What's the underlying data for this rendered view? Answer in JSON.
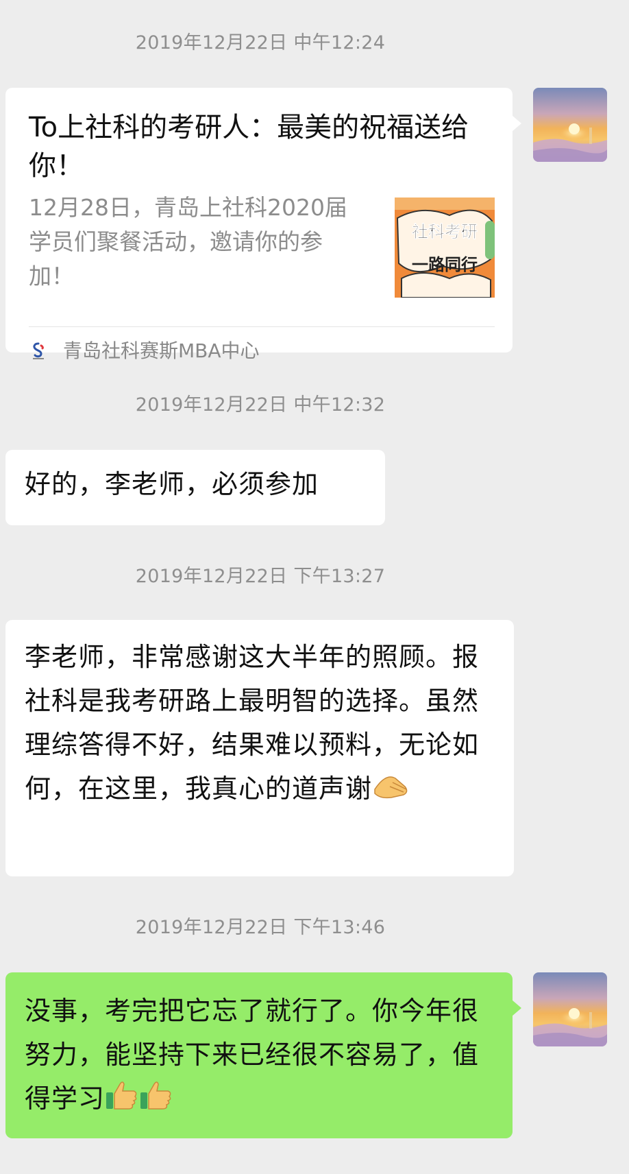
{
  "timestamps": [
    "2019年12月22日 中午12:24",
    "2019年12月22日 中午12:32",
    "2019年12月22日 下午13:27",
    "2019年12月22日 下午13:46"
  ],
  "messages": {
    "card": {
      "title": "To上社科的考研人：最美的祝福送给你！",
      "description": "12月28日，青岛上社科2020届学员们聚餐活动，邀请你的参加！",
      "thumbnail_text_1": "社科考研",
      "thumbnail_text_2": "一路同行",
      "source": "青岛社科赛斯MBA中心",
      "source_icon": "organization-logo-icon"
    },
    "reply_1": "好的，李老师，必须参加",
    "reply_2": "李老师，非常感谢这大半年的照顾。报社科是我考研路上最明智的选择。虽然理综答得不好，结果难以预料，无论如何，在这里，我真心的道声谢",
    "reply_2_emoji": "bowing-hand-emoji",
    "own_reply": "没事，考完把它忘了就行了。你今年很努力，能坚持下来已经很不容易了，值得学习",
    "own_reply_emoji": "thumbs-up-emoji"
  },
  "colors": {
    "background": "#ededed",
    "own_bubble": "#95ec69",
    "other_bubble": "#ffffff",
    "timestamp": "#8e8e8e"
  }
}
